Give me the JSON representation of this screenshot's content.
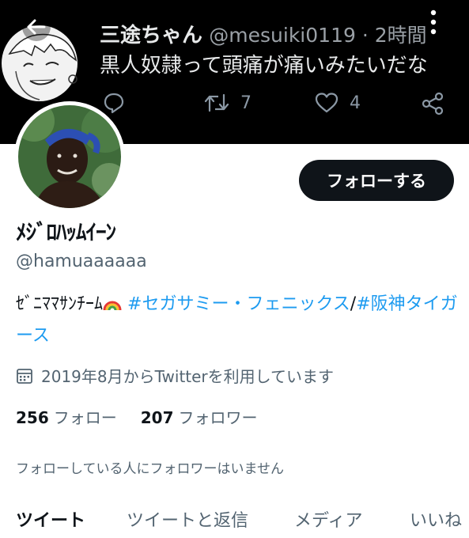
{
  "banner": {
    "name": "三途ちゃん",
    "handle": "@mesuiki0119 · 2時間",
    "text": "黒人奴隷って頭痛が痛いみたいだな",
    "retweets": "7",
    "likes": "4"
  },
  "profile": {
    "display_name": "ﾒｼﾞﾛﾊｯﾑｲｰﾝ",
    "username": "@hamuaaaaaa",
    "bio_prefix": "ｾﾞﾆﾏﾏｻﾝﾁｰﾑ",
    "bio_hashtag_1": "#セガサミー・フェニックス",
    "bio_separator": "/",
    "bio_hashtag_2": "#阪神タイガース",
    "joined": "2019年8月からTwitterを利用しています",
    "following_count": "256",
    "following_label": "フォロー",
    "followers_count": "207",
    "followers_label": "フォロワー",
    "follow_button": "フォローする",
    "notice": "フォローしている人にフォロワーはいません"
  },
  "tabs": [
    {
      "label": "ツイート"
    },
    {
      "label": "ツイートと返信"
    },
    {
      "label": "メディア"
    },
    {
      "label": "いいね"
    }
  ],
  "icons": {
    "back": "arrow-left-icon",
    "more": "more-vertical-icon",
    "reply": "reply-icon",
    "retweet": "retweet-icon",
    "like": "heart-icon",
    "share": "share-icon",
    "calendar": "calendar-icon",
    "rainbow": "rainbow-emoji"
  },
  "colors": {
    "accent": "#1d9bf0",
    "text": "#0f1419",
    "secondary": "#536471",
    "button_bg": "#0f1419"
  },
  "active_tab": "ツイート"
}
